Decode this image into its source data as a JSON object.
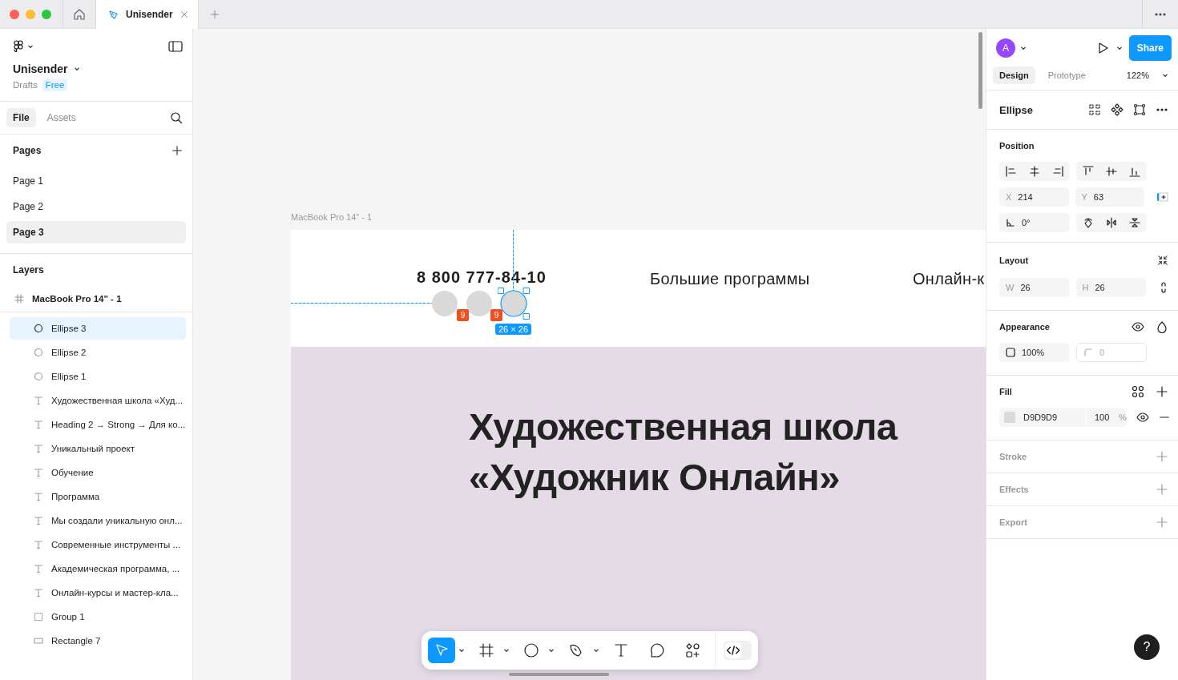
{
  "tabs": [
    {
      "label": "Unisender",
      "selected": true
    }
  ],
  "file": {
    "name": "Unisender",
    "location": "Drafts",
    "plan": "Free"
  },
  "panel_tabs": [
    {
      "label": "File",
      "selected": true
    },
    {
      "label": "Assets",
      "selected": false
    }
  ],
  "pages": {
    "title": "Pages",
    "items": [
      {
        "label": "Page 1",
        "selected": false
      },
      {
        "label": "Page 2",
        "selected": false
      },
      {
        "label": "Page 3",
        "selected": true
      }
    ]
  },
  "layers": {
    "title": "Layers",
    "items": [
      {
        "label": "MacBook Pro 14\" - 1",
        "kind": "frame",
        "selected": false,
        "children": [
          {
            "label": "Ellipse 3",
            "kind": "ellipse",
            "selected": true
          },
          {
            "label": "Ellipse 2",
            "kind": "ellipse",
            "selected": false
          },
          {
            "label": "Ellipse 1",
            "kind": "ellipse",
            "selected": false
          },
          {
            "label": "Художественная школа «Худ...",
            "kind": "text",
            "selected": false
          },
          {
            "label": "Heading 2 → Strong → Для ко...",
            "kind": "text",
            "selected": false
          },
          {
            "label": "Уникальный проект",
            "kind": "text",
            "selected": false
          },
          {
            "label": "Обучение",
            "kind": "text",
            "selected": false
          },
          {
            "label": "Программа",
            "kind": "text",
            "selected": false
          },
          {
            "label": "Мы создали уникальную онл...",
            "kind": "text",
            "selected": false
          },
          {
            "label": "Современные инструменты ...",
            "kind": "text",
            "selected": false
          },
          {
            "label": "Академическая программа, ...",
            "kind": "text",
            "selected": false
          },
          {
            "label": "Онлайн-курсы и мастер-кла...",
            "kind": "text",
            "selected": false
          },
          {
            "label": "Group 1",
            "kind": "group",
            "selected": false
          },
          {
            "label": "Rectangle 7",
            "kind": "rectangle",
            "selected": false
          }
        ]
      }
    ]
  },
  "canvas": {
    "frame_label": "MacBook Pro 14\" - 1",
    "phone": "8 800 777-84-10",
    "nav": [
      "Большие программы",
      "Онлайн-к"
    ],
    "spacing_badges": [
      "9",
      "9"
    ],
    "size_label": "26 × 26",
    "heading": "Художественная школа «Художник Онлайн»"
  },
  "toolbar": [
    {
      "kind": "move",
      "selected": true,
      "menu": true
    },
    {
      "kind": "frame",
      "selected": false,
      "menu": true
    },
    {
      "kind": "shape",
      "selected": false,
      "menu": true
    },
    {
      "kind": "pen",
      "selected": false,
      "menu": true
    },
    {
      "kind": "text",
      "selected": false,
      "menu": false
    },
    {
      "kind": "comment",
      "selected": false,
      "menu": false
    },
    {
      "kind": "actions",
      "selected": false,
      "menu": false
    }
  ],
  "help": "?",
  "inspector": {
    "avatar": "A",
    "share": "Share",
    "tabs": [
      {
        "label": "Design",
        "selected": true
      },
      {
        "label": "Prototype",
        "selected": false
      }
    ],
    "zoom": "122%",
    "selection": "Ellipse",
    "position": {
      "title": "Position",
      "x": {
        "label": "X",
        "value": "214"
      },
      "y": {
        "label": "Y",
        "value": "63"
      },
      "rotation": "0°"
    },
    "layout": {
      "title": "Layout",
      "w": {
        "label": "W",
        "value": "26"
      },
      "h": {
        "label": "H",
        "value": "26"
      }
    },
    "appearance": {
      "title": "Appearance",
      "opacity": "100%",
      "corner_radius": "0"
    },
    "fill": {
      "title": "Fill",
      "color": "#d9d9d9",
      "hex": "D9D9D9",
      "opacity": "100",
      "unit": "%"
    },
    "empty_sections": [
      "Stroke",
      "Effects",
      "Export"
    ]
  }
}
